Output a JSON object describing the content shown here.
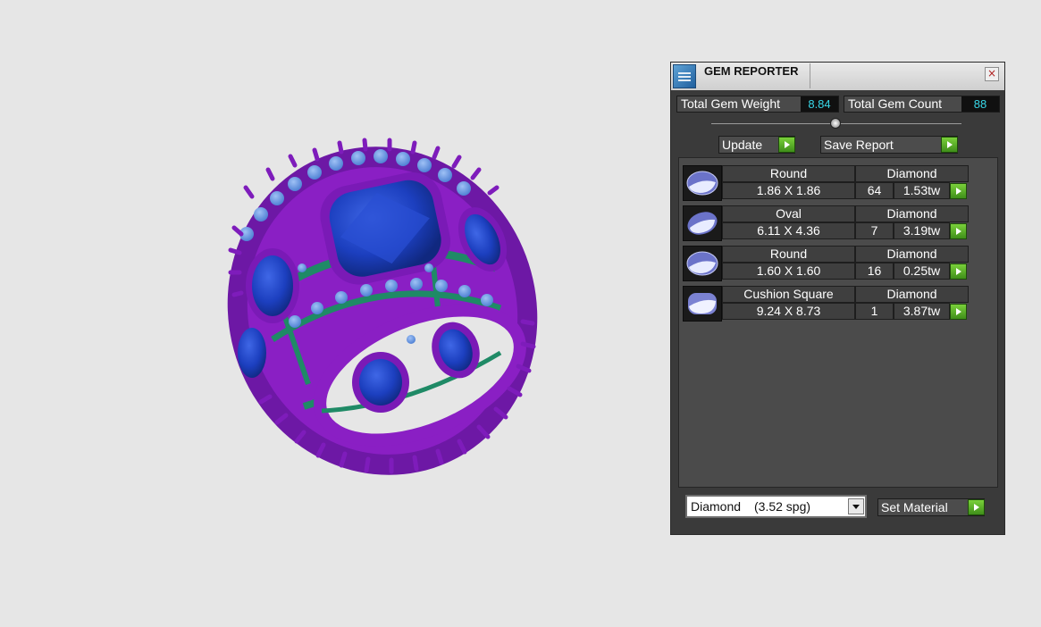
{
  "panel": {
    "title": "GEM REPORTER",
    "close_glyph": "×",
    "total_weight_label": "Total Gem Weight",
    "total_weight_value": "8.84",
    "total_count_label": "Total Gem Count",
    "total_count_value": "88",
    "update_label": "Update",
    "save_report_label": "Save Report",
    "set_material_label": "Set Material"
  },
  "gems": [
    {
      "shape": "Round",
      "material": "Diamond",
      "size": "1.86 X 1.86",
      "count": "64",
      "weight": "1.53tw",
      "thumb": "round"
    },
    {
      "shape": "Oval",
      "material": "Diamond",
      "size": "6.11 X 4.36",
      "count": "7",
      "weight": "3.19tw",
      "thumb": "oval"
    },
    {
      "shape": "Round",
      "material": "Diamond",
      "size": "1.60 X 1.60",
      "count": "16",
      "weight": "0.25tw",
      "thumb": "round"
    },
    {
      "shape": "Cushion Square",
      "material": "Diamond",
      "size": "9.24 X 8.73",
      "count": "1",
      "weight": "3.87tw",
      "thumb": "cushion"
    }
  ],
  "material_select": {
    "name": "Diamond",
    "spg": "(3.52 spg)"
  },
  "colors": {
    "metal": "#8a1fc4",
    "gem": "#1c3fbf",
    "melee": "#5b8fe0",
    "gallery": "#1f8a66",
    "accent_value": "#38d7e8",
    "button_green": "#5aae25"
  },
  "icons": {
    "close": "close-icon",
    "play": "play-arrow-icon",
    "dropdown": "chevron-down-icon",
    "app": "gem-reporter-icon"
  }
}
